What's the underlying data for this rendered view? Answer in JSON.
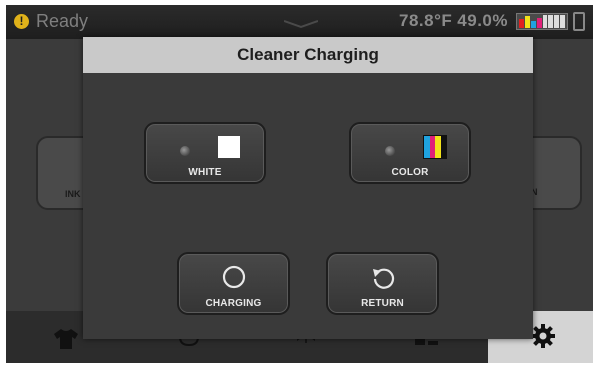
{
  "status": {
    "state": "Ready",
    "temperature": "78.8°F",
    "humidity": "49.0%",
    "warning_icon": "warning-icon"
  },
  "background": {
    "left_button_label": "INK",
    "right_button_label": "N"
  },
  "dialog": {
    "title": "Cleaner Charging",
    "buttons": {
      "white": "WHITE",
      "color": "COLOR",
      "charging": "CHARGING",
      "return": "RETURN"
    }
  },
  "colors": {
    "header_bg": "#c9c9c9",
    "screen_bg": "#3b3b3b",
    "warning": "#e0b21a",
    "cyan": "#1fa3e0",
    "magenta": "#e0207a",
    "yellow": "#f2e21a",
    "black": "#111111"
  },
  "ink_levels": [
    {
      "color": "#e02020",
      "level": 0.7
    },
    {
      "color": "#f2e21a",
      "level": 0.9
    },
    {
      "color": "#1fa3e0",
      "level": 0.5
    },
    {
      "color": "#e0207a",
      "level": 0.8
    },
    {
      "color": "#dddddd",
      "level": 1.0
    },
    {
      "color": "#dddddd",
      "level": 1.0
    },
    {
      "color": "#dddddd",
      "level": 1.0
    },
    {
      "color": "#dddddd",
      "level": 1.0
    }
  ],
  "icons": {
    "nav": [
      "shirt-icon",
      "heart-icon",
      "alignment-icon",
      "ink-drop-icon",
      "gear-icon"
    ],
    "charging": "circle-icon",
    "return": "return-arrow-icon"
  }
}
